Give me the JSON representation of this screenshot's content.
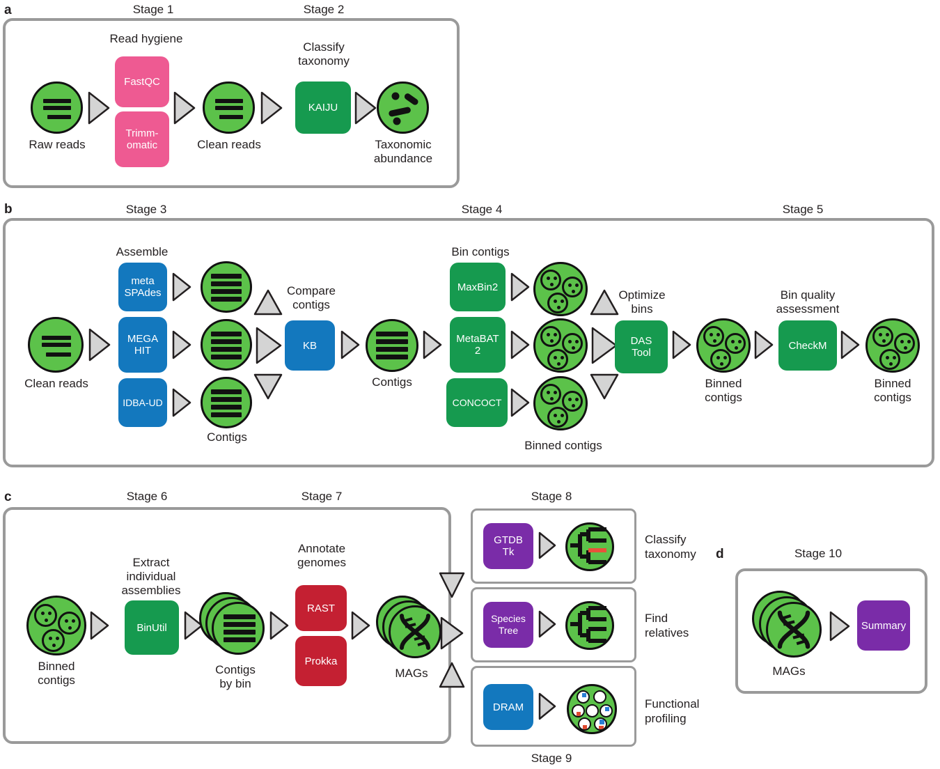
{
  "figure": {
    "type": "workflow-diagram",
    "panels": [
      {
        "letter": "a",
        "stages": [
          "Stage 1",
          "Stage 2"
        ]
      },
      {
        "letter": "b",
        "stages": [
          "Stage 3",
          "Stage 4",
          "Stage 5"
        ]
      },
      {
        "letter": "c",
        "stages": [
          "Stage 6",
          "Stage 7",
          "Stage 8",
          "Stage 9"
        ]
      },
      {
        "letter": "d",
        "stages": [
          "Stage 10"
        ]
      }
    ]
  },
  "panel_a": {
    "letter": "a",
    "stage1_label": "Stage 1",
    "stage2_label": "Stage 2",
    "raw_reads": "Raw reads",
    "read_hygiene": "Read hygiene",
    "fastqc": "FastQC",
    "trimmomatic_l1": "Trimm-",
    "trimmomatic_l2": "omatic",
    "clean_reads": "Clean reads",
    "classify_l1": "Classify",
    "classify_l2": "taxonomy",
    "kaiju": "KAIJU",
    "tax_abund_l1": "Taxonomic",
    "tax_abund_l2": "abundance"
  },
  "panel_b": {
    "letter": "b",
    "stage3_label": "Stage 3",
    "stage4_label": "Stage 4",
    "stage5_label": "Stage 5",
    "clean_reads": "Clean reads",
    "assemble": "Assemble",
    "metaspades_l1": "meta",
    "metaspades_l2": "SPAdes",
    "megahit_l1": "MEGA",
    "megahit_l2": "HIT",
    "idbaud": "IDBA-UD",
    "contigs_left": "Contigs",
    "compare_l1": "Compare",
    "compare_l2": "contigs",
    "kb": "KB",
    "contigs_mid": "Contigs",
    "bin_contigs": "Bin contigs",
    "maxbin2": "MaxBin2",
    "metabat_l1": "MetaBAT",
    "metabat_l2": "2",
    "concoct": "CONCOCT",
    "binned_contigs_mid": "Binned contigs",
    "optimize_l1": "Optimize",
    "optimize_l2": "bins",
    "dastool_l1": "DAS",
    "dastool_l2": "Tool",
    "binned_contigs_l1": "Binned",
    "binned_contigs_l2": "contigs",
    "binqual_l1": "Bin quality",
    "binqual_l2": "assessment",
    "checkm": "CheckM",
    "binned_contigs_r1": "Binned",
    "binned_contigs_r2": "contigs"
  },
  "panel_c": {
    "letter": "c",
    "stage6_label": "Stage 6",
    "stage7_label": "Stage 7",
    "stage8_label": "Stage 8",
    "stage9_label": "Stage 9",
    "binned_contigs_l1": "Binned",
    "binned_contigs_l2": "contigs",
    "extract_l1": "Extract",
    "extract_l2": "individual",
    "extract_l3": "assemblies",
    "binutil": "BinUtil",
    "contigs_by_bin_l1": "Contigs",
    "contigs_by_bin_l2": "by bin",
    "annotate_l1": "Annotate",
    "annotate_l2": "genomes",
    "rast": "RAST",
    "prokka": "Prokka",
    "mags": "MAGs",
    "gtdbtk_l1": "GTDB",
    "gtdbtk_l2": "Tk",
    "classify_tax_l1": "Classify",
    "classify_tax_l2": "taxonomy",
    "species_tree_l1": "Species",
    "species_tree_l2": "Tree",
    "find_rel_l1": "Find",
    "find_rel_l2": "relatives",
    "dram": "DRAM",
    "func_prof_l1": "Functional",
    "func_prof_l2": "profiling"
  },
  "panel_d": {
    "letter": "d",
    "stage10_label": "Stage 10",
    "mags": "MAGs",
    "summary": "Summary"
  },
  "colors": {
    "pink": "#ee5a92",
    "dark_green": "#169a4f",
    "light_green": "#5cc24a",
    "blue": "#1378be",
    "red": "#c42032",
    "purple": "#7a2ca8",
    "arrow_grey": "#d4d4d4",
    "frame_grey": "#9a9a9a",
    "outline": "#111111",
    "tree_highlight": "#e8523a"
  }
}
